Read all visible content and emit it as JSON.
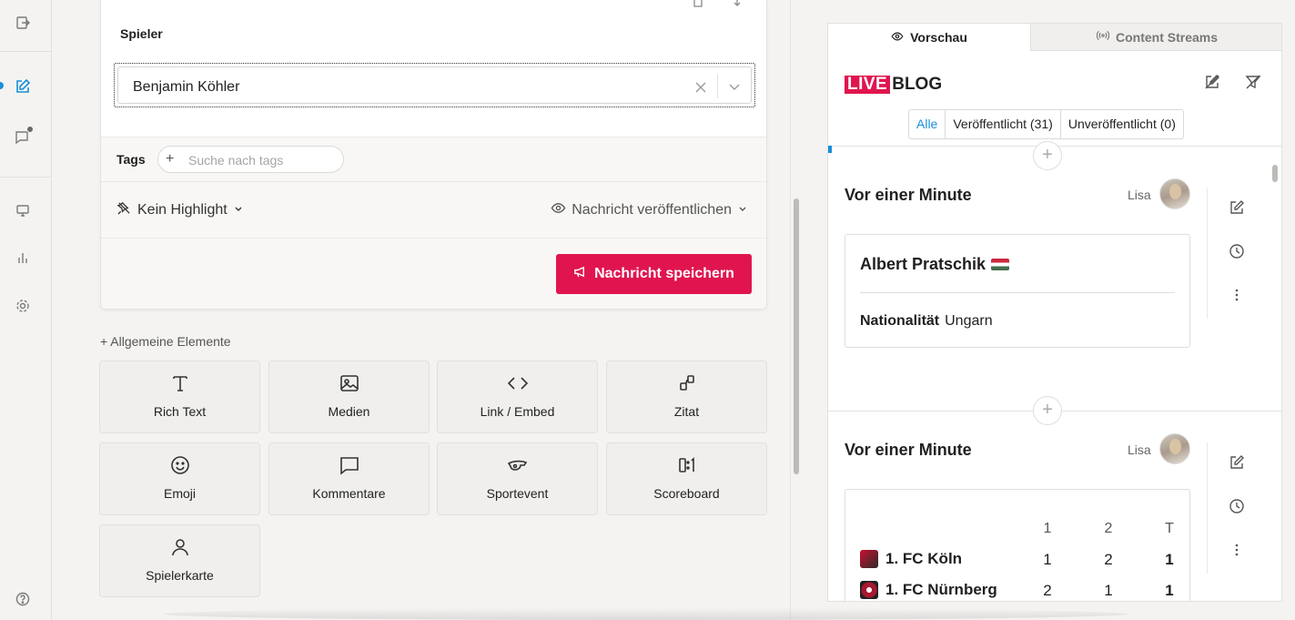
{
  "rail": {
    "icons": [
      "exit-icon",
      "edit-icon",
      "chat-icon",
      "monitor-icon",
      "chart-icon",
      "settings-icon",
      "help-icon"
    ]
  },
  "editor": {
    "spieler_label": "Spieler",
    "select_value": "Benjamin Köhler",
    "tags_label": "Tags",
    "tags_placeholder": "Suche nach tags",
    "highlight_label": "Kein Highlight",
    "publish_label": "Nachricht veröffentlichen",
    "save_label": "Nachricht speichern"
  },
  "elements": {
    "section_label": "Allgemeine Elemente",
    "tiles": [
      {
        "label": "Rich Text",
        "icon": "text-icon"
      },
      {
        "label": "Medien",
        "icon": "image-icon"
      },
      {
        "label": "Link / Embed",
        "icon": "code-icon"
      },
      {
        "label": "Zitat",
        "icon": "quote-icon"
      },
      {
        "label": "Emoji",
        "icon": "smiley-icon"
      },
      {
        "label": "Kommentare",
        "icon": "comment-icon"
      },
      {
        "label": "Sportevent",
        "icon": "whistle-icon"
      },
      {
        "label": "Scoreboard",
        "icon": "scoreboard-icon"
      },
      {
        "label": "Spielerkarte",
        "icon": "person-icon"
      }
    ]
  },
  "preview": {
    "tabs": [
      {
        "label": "Vorschau",
        "active": true
      },
      {
        "label": "Content Streams",
        "active": false
      }
    ],
    "logo_live": "LIVE",
    "logo_blog": "BLOG",
    "filters": [
      "Alle",
      "Veröffentlicht (31)",
      "Unveröffentlicht (0)"
    ],
    "entries": [
      {
        "time": "Vor einer Minute",
        "author": "Lisa",
        "card": {
          "name": "Albert Pratschik",
          "flag": "hungary-flag",
          "field_label": "Nationalität",
          "field_value": "Ungarn"
        }
      },
      {
        "time": "Vor einer Minute",
        "author": "Lisa",
        "scoreboard": {
          "headers": [
            "1",
            "2",
            "T"
          ],
          "rows": [
            {
              "team": "1. FC Köln",
              "values": [
                "1",
                "2",
                "1"
              ]
            },
            {
              "team": "1. FC Nürnberg",
              "values": [
                "2",
                "1",
                "1"
              ]
            }
          ]
        }
      }
    ]
  },
  "colors": {
    "accent": "#e0154f",
    "link": "#1a8fd6"
  }
}
